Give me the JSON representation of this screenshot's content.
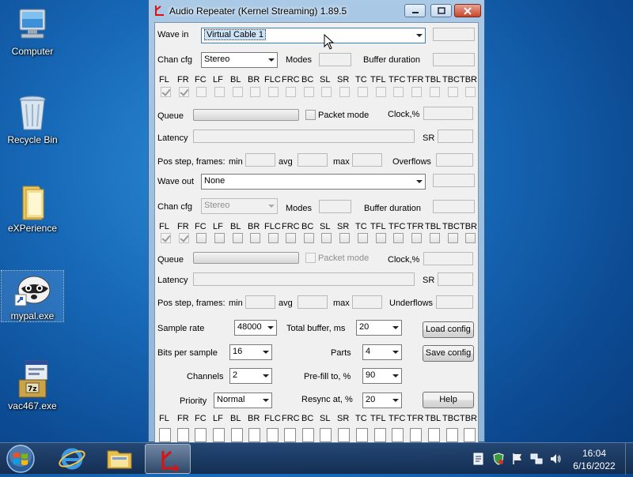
{
  "desktop": {
    "icons": [
      {
        "label": "Computer"
      },
      {
        "label": "Recycle Bin"
      },
      {
        "label": "eXPerience"
      },
      {
        "label": "mypal.exe"
      },
      {
        "label": "vac467.exe"
      }
    ]
  },
  "window": {
    "title": "Audio Repeater (Kernel Streaming) 1.89.5"
  },
  "input": {
    "wave_label": "Wave in",
    "wave_value": "Virtual Cable 1",
    "chan_cfg_label": "Chan cfg",
    "chan_cfg_value": "Stereo",
    "modes_label": "Modes",
    "buffer_duration_label": "Buffer duration",
    "channels": [
      "FL",
      "FR",
      "FC",
      "LF",
      "BL",
      "BR",
      "FLC",
      "FRC",
      "BC",
      "SL",
      "SR",
      "TC",
      "TFL",
      "TFC",
      "TFR",
      "TBL",
      "TBC",
      "TBR"
    ],
    "queue_label": "Queue",
    "packet_mode_label": "Packet mode",
    "clock_label": "Clock,%",
    "latency_label": "Latency",
    "sr_label": "SR",
    "pos_step_label": "Pos step, frames:",
    "min_label": "min",
    "avg_label": "avg",
    "max_label": "max",
    "flows_label": "Overflows"
  },
  "output": {
    "wave_label": "Wave out",
    "wave_value": "None",
    "chan_cfg_label": "Chan cfg",
    "chan_cfg_value": "Stereo",
    "modes_label": "Modes",
    "buffer_duration_label": "Buffer duration",
    "queue_label": "Queue",
    "packet_mode_label": "Packet mode",
    "clock_label": "Clock,%",
    "latency_label": "Latency",
    "sr_label": "SR",
    "pos_step_label": "Pos step, frames:",
    "min_label": "min",
    "avg_label": "avg",
    "max_label": "max",
    "flows_label": "Underflows"
  },
  "settings": {
    "sample_rate_label": "Sample rate",
    "sample_rate_value": "48000",
    "total_buffer_label": "Total buffer, ms",
    "total_buffer_value": "20",
    "load_config_label": "Load config",
    "bits_label": "Bits per sample",
    "bits_value": "16",
    "parts_label": "Parts",
    "parts_value": "4",
    "save_config_label": "Save config",
    "channels_label": "Channels",
    "channels_value": "2",
    "prefill_label": "Pre-fill to, %",
    "prefill_value": "90",
    "priority_label": "Priority",
    "priority_value": "Normal",
    "resync_label": "Resync at, %",
    "resync_value": "20",
    "help_label": "Help"
  },
  "taskbar": {
    "time": "16:04",
    "date": "6/16/2022"
  }
}
